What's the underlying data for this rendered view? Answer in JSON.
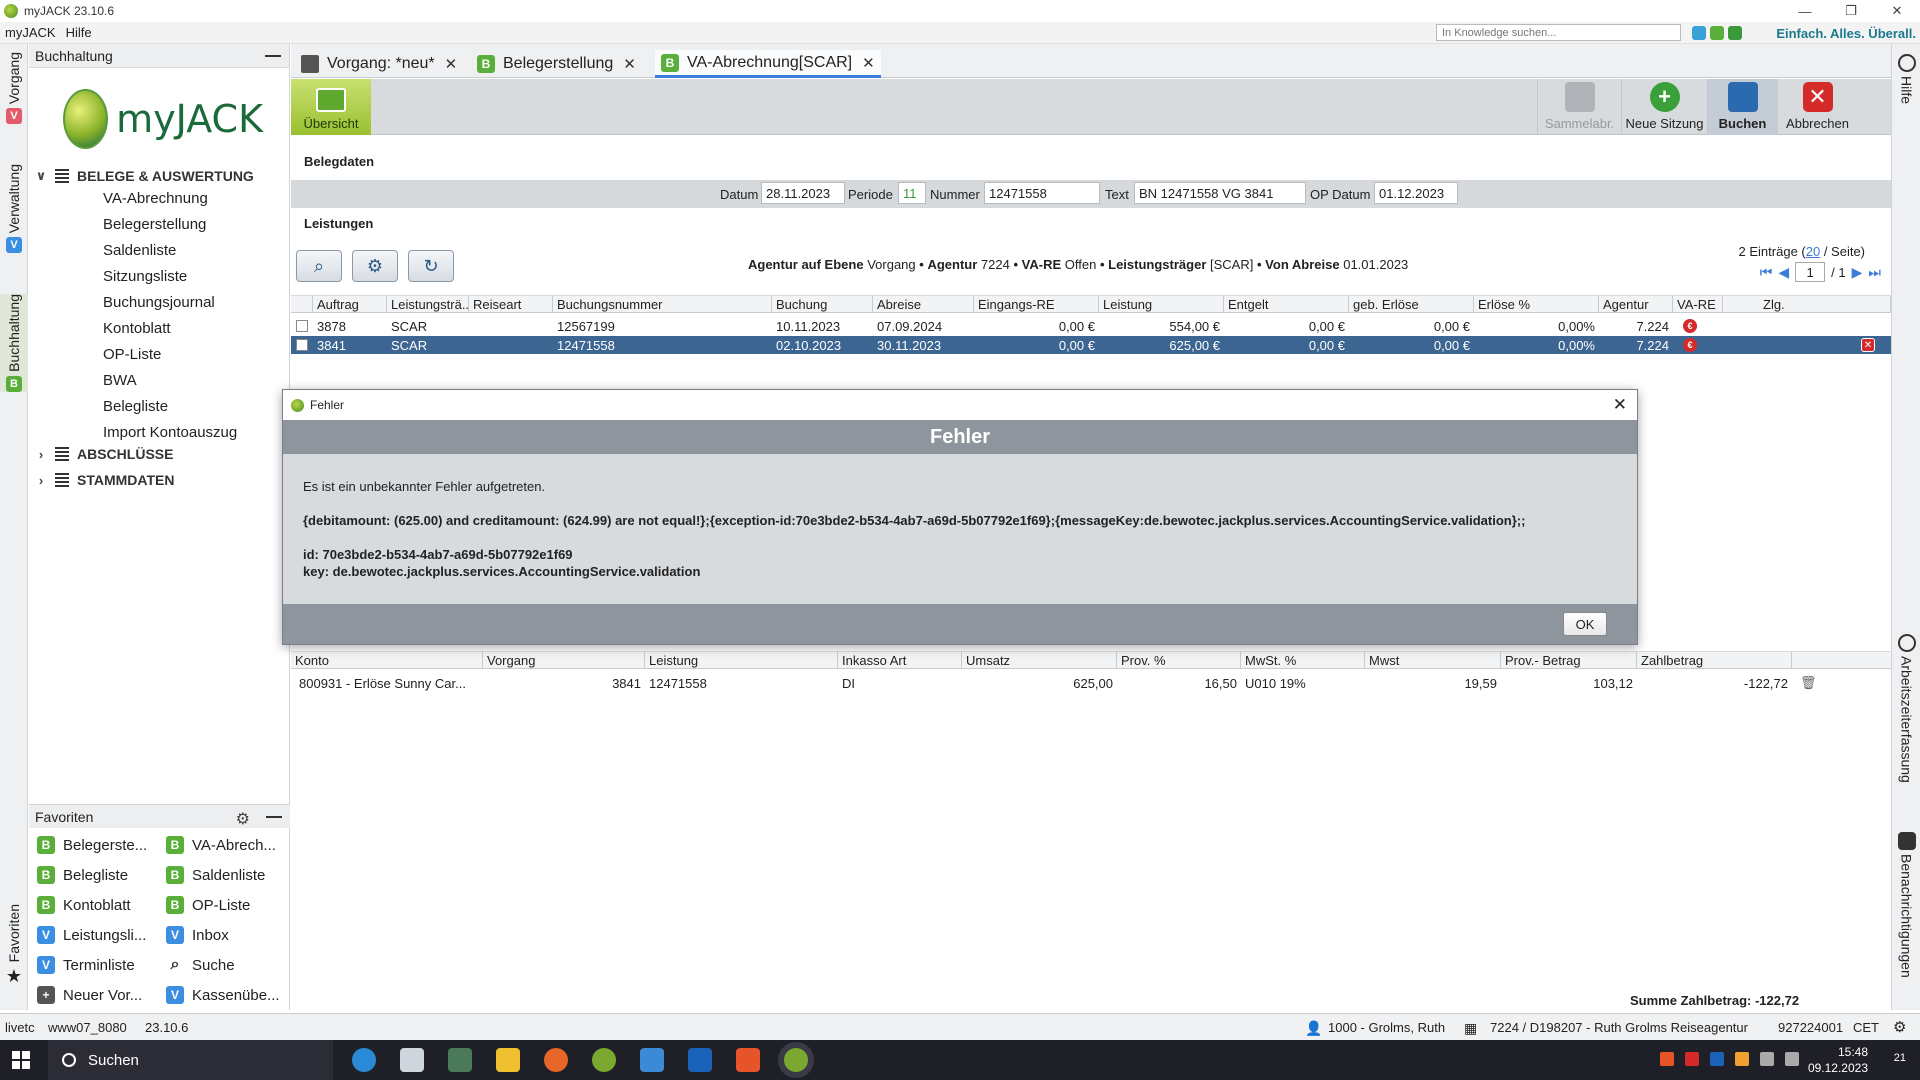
{
  "window": {
    "title": "myJACK 23.10.6"
  },
  "menu": {
    "items": [
      "myJACK",
      "Hilfe"
    ]
  },
  "knowledge_search": {
    "placeholder": "In Knowledge suchen..."
  },
  "slogan": "Einfach. Alles. Überall.",
  "left_tabs": [
    {
      "label": "Vorgang",
      "badge": "V",
      "color": "#e35a6a"
    },
    {
      "label": "Verwaltung",
      "badge": "V",
      "color": "#3b8ee0"
    },
    {
      "label": "Buchhaltung",
      "badge": "B",
      "color": "#5aaf3a"
    },
    {
      "label": "Favoriten"
    }
  ],
  "sidebar": {
    "header": "Buchhaltung",
    "logo_text": "myJACK",
    "sections": [
      {
        "label": "BELEGE & AUSWERTUNG",
        "expanded": true,
        "items": [
          "VA-Abrechnung",
          "Belegerstellung",
          "Saldenliste",
          "Sitzungsliste",
          "Buchungsjournal",
          "Kontoblatt",
          "OP-Liste",
          "BWA",
          "Belegliste",
          "Import Kontoauszug"
        ]
      },
      {
        "label": "ABSCHLÜSSE",
        "expanded": false
      },
      {
        "label": "STAMMDATEN",
        "expanded": false
      }
    ],
    "favorites_header": "Favoriten",
    "favorites": [
      {
        "label": "Belegerste...",
        "badge": "B"
      },
      {
        "label": "VA-Abrech...",
        "badge": "B"
      },
      {
        "label": "Belegliste",
        "badge": "B"
      },
      {
        "label": "Saldenliste",
        "badge": "B"
      },
      {
        "label": "Kontoblatt",
        "badge": "B"
      },
      {
        "label": "OP-Liste",
        "badge": "B"
      },
      {
        "label": "Leistungsli...",
        "badge": "V"
      },
      {
        "label": "Inbox",
        "badge": "V"
      },
      {
        "label": "Terminliste",
        "badge": "V"
      },
      {
        "label": "Suche",
        "badge": "search"
      },
      {
        "label": "Neuer Vor...",
        "badge": "new"
      },
      {
        "label": "Kassenübe...",
        "badge": "V"
      }
    ]
  },
  "tabs": [
    {
      "label": "Vorgang: *neu*",
      "icon": "folder-icon"
    },
    {
      "label": "Belegerstellung",
      "icon": "B"
    },
    {
      "label": "VA-Abrechnung[SCAR]",
      "icon": "B",
      "active": true
    }
  ],
  "toolbar": {
    "overview": "Übersicht",
    "sammelabr": "Sammelabr.",
    "neue_sitzung": "Neue Sitzung",
    "buchen": "Buchen",
    "abbrechen": "Abbrechen"
  },
  "belegdaten": {
    "title": "Belegdaten",
    "datum_label": "Datum",
    "datum": "28.11.2023",
    "periode_label": "Periode",
    "periode": "11",
    "nummer_label": "Nummer",
    "nummer": "12471558",
    "text_label": "Text",
    "text": "BN 12471558 VG 3841",
    "opdatum_label": "OP Datum",
    "opdatum": "01.12.2023"
  },
  "leistungen": {
    "title": "Leistungen",
    "filter": {
      "l1": "Agentur auf Ebene",
      "v1": "Vorgang",
      "l2": "Agentur",
      "v2": "7224",
      "l3": "VA-RE",
      "v3": "Offen",
      "l4": "Leistungsträger",
      "v4": "[SCAR]",
      "l5": "Von Abreise",
      "v5": "01.01.2023",
      "sep": "•"
    },
    "entries_prefix": "2 Einträge (",
    "entries_per_page": "20",
    "entries_suffix": " / Seite)",
    "page_current": "1",
    "page_total": "/ 1",
    "columns": [
      "Auftrag",
      "Leistungsträ...",
      "Reiseart",
      "Buchungsnummer",
      "Buchung",
      "Abreise",
      "Eingangs-RE",
      "Leistung",
      "Entgelt",
      "geb. Erlöse",
      "Erlöse %",
      "Agentur",
      "VA-RE",
      "Zlg."
    ],
    "rows": [
      {
        "auftrag": "3878",
        "traeger": "SCAR",
        "reiseart": "",
        "buchungsnummer": "12567199",
        "buchung": "10.11.2023",
        "abreise": "07.09.2024",
        "eingang": "0,00 €",
        "leistung": "554,00 €",
        "entgelt": "0,00 €",
        "geb": "0,00 €",
        "erloese": "0,00%",
        "agentur": "7.224"
      },
      {
        "auftrag": "3841",
        "traeger": "SCAR",
        "reiseart": "",
        "buchungsnummer": "12471558",
        "buchung": "02.10.2023",
        "abreise": "30.11.2023",
        "eingang": "0,00 €",
        "leistung": "625,00 €",
        "entgelt": "0,00 €",
        "geb": "0,00 €",
        "erloese": "0,00%",
        "agentur": "7.224"
      }
    ]
  },
  "buchungen": {
    "columns": [
      "Konto",
      "Vorgang",
      "Leistung",
      "Inkasso Art",
      "Umsatz",
      "Prov. %",
      "MwSt. %",
      "Mwst",
      "Prov.- Betrag",
      "Zahlbetrag"
    ],
    "rows": [
      {
        "konto": "800931 - Erlöse Sunny Car...",
        "vorgang": "3841",
        "leistung": "12471558",
        "inkasso": "DI",
        "umsatz": "625,00",
        "prov": "16,50",
        "mwst_pct": "U010 19%",
        "mwst": "19,59",
        "prov_betrag": "103,12",
        "zahlbetrag": "-122,72"
      }
    ],
    "sum": "Summe Zahlbetrag: -122,72"
  },
  "right_tabs": [
    "Hilfe",
    "Arbeitszeiterfassung",
    "Benachrichtigungen"
  ],
  "status": {
    "env": "livetc",
    "server": "www07_8080",
    "version": "23.10.6",
    "user": "1000 - Grolms, Ruth",
    "agency": "7224 / D198207 - Ruth Grolms Reiseagentur",
    "code": "927224001",
    "tz": "CET"
  },
  "dialog": {
    "title": "Fehler",
    "banner": "Fehler",
    "message": "Es ist ein unbekannter Fehler aufgetreten.",
    "detail": "{debitamount: (625.00) and creditamount: (624.99) are not equal!};{exception-id:70e3bde2-b534-4ab7-a69d-5b07792e1f69};{messageKey:de.bewotec.jackplus.services.AccountingService.validation};;",
    "id_line": "id: 70e3bde2-b534-4ab7-a69d-5b07792e1f69",
    "key_line": "key: de.bewotec.jackplus.services.AccountingService.validation",
    "ok": "OK"
  },
  "taskbar": {
    "search": "Suchen",
    "time": "15:48",
    "date": "09.12.2023",
    "notif_count": "21"
  }
}
